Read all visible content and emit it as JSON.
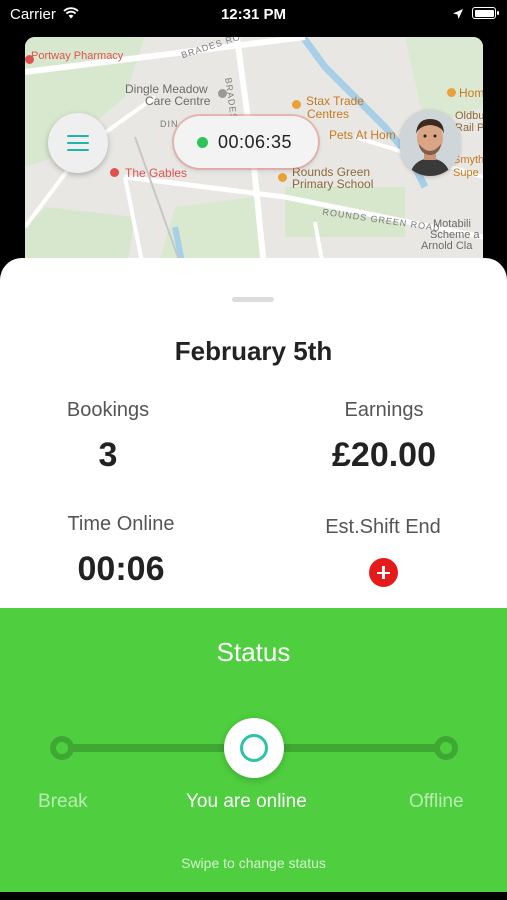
{
  "status_bar": {
    "carrier": "Carrier",
    "time": "12:31 PM"
  },
  "map": {
    "labels": {
      "portway": "Portway Pharmacy",
      "brades_road": "BRADES RO",
      "dingle_meadow": "Dingle Meadow",
      "care_centre": "Care Centre",
      "brades_road_v": "BRADES ROA",
      "stax_trade": "Stax Trade",
      "centres": "Centres",
      "din": "DIN",
      "pets_at_home": "Pets At Hom",
      "the_gables": "The Gables",
      "rounds_green": "Rounds Green",
      "primary_school": "Primary School",
      "rounds_green_road": "ROUNDS GREEN ROAD",
      "hom": "Hom",
      "oldbury": "Oldbury",
      "rail_park": "Rail Pa",
      "smyth": "Smyth",
      "super": "Supe",
      "motabil": "Motabili",
      "scheme": "Scheme a",
      "arnold": "Arnold Cla"
    }
  },
  "timer": {
    "value": "00:06:35",
    "status_color": "#2fc45a"
  },
  "summary": {
    "date": "February 5th",
    "bookings_label": "Bookings",
    "bookings_value": "3",
    "earnings_label": "Earnings",
    "earnings_value": "£20.00",
    "time_online_label": "Time Online",
    "time_online_value": "00:06",
    "shift_end_label": "Est.Shift End"
  },
  "status": {
    "title": "Status",
    "options": [
      "Break",
      "You are online",
      "Offline"
    ],
    "selected": "You are online",
    "hint": "Swipe to change status",
    "panel_color": "#4fcf3f"
  },
  "icons": {
    "menu": "hamburger-menu-icon",
    "add": "plus-circle-icon",
    "wifi": "wifi-icon",
    "location": "location-arrow-icon",
    "battery": "battery-icon"
  }
}
